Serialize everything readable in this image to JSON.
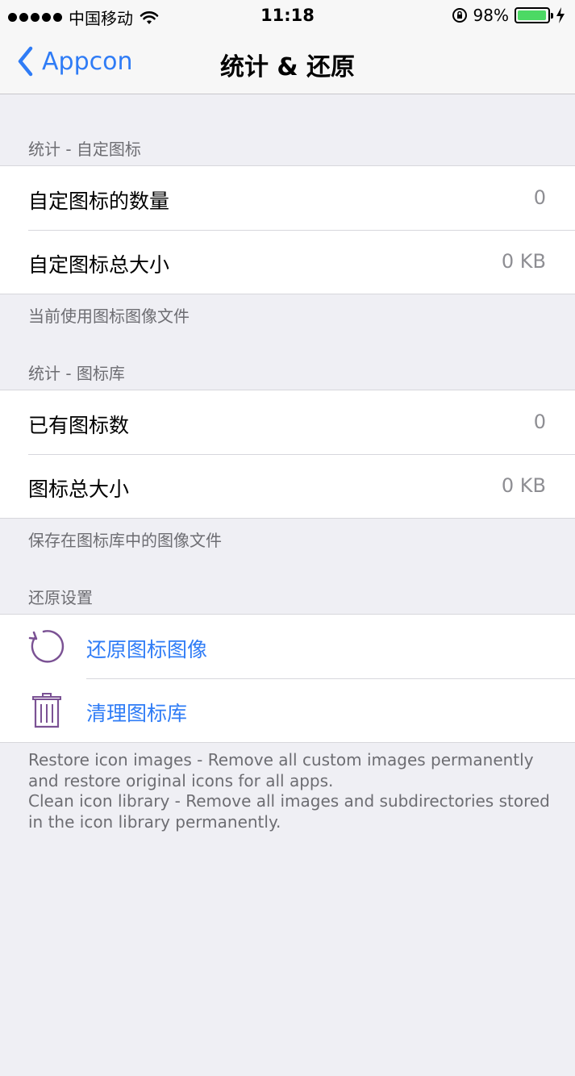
{
  "status_bar": {
    "carrier": "中国移动",
    "time": "11:18",
    "battery_percent": "98%",
    "battery_level": 0.98,
    "battery_color": "#4CD964"
  },
  "nav": {
    "back_label": "Appcon",
    "title": "统计 & 还原",
    "accent": "#2F7CF6"
  },
  "sections": {
    "custom_icons": {
      "header": "统计 - 自定图标",
      "rows": [
        {
          "label": "自定图标的数量",
          "value": "0"
        },
        {
          "label": "自定图标总大小",
          "value": "0 KB"
        }
      ],
      "footer": "当前使用图标图像文件"
    },
    "icon_library": {
      "header": "统计 - 图标库",
      "rows": [
        {
          "label": "已有图标数",
          "value": "0"
        },
        {
          "label": "图标总大小",
          "value": "0 KB"
        }
      ],
      "footer": "保存在图标库中的图像文件"
    },
    "restore": {
      "header": "还原设置",
      "actions": [
        {
          "label": "还原图标图像",
          "icon": "restore-icon"
        },
        {
          "label": "清理图标库",
          "icon": "trash-icon"
        }
      ],
      "icon_color": "#7B5294"
    }
  },
  "description": {
    "line1": "Restore icon images - Remove all custom images permanently and restore original icons for all apps.",
    "line2": "Clean icon library - Remove all images and subdirectories stored in the icon library permanently."
  }
}
